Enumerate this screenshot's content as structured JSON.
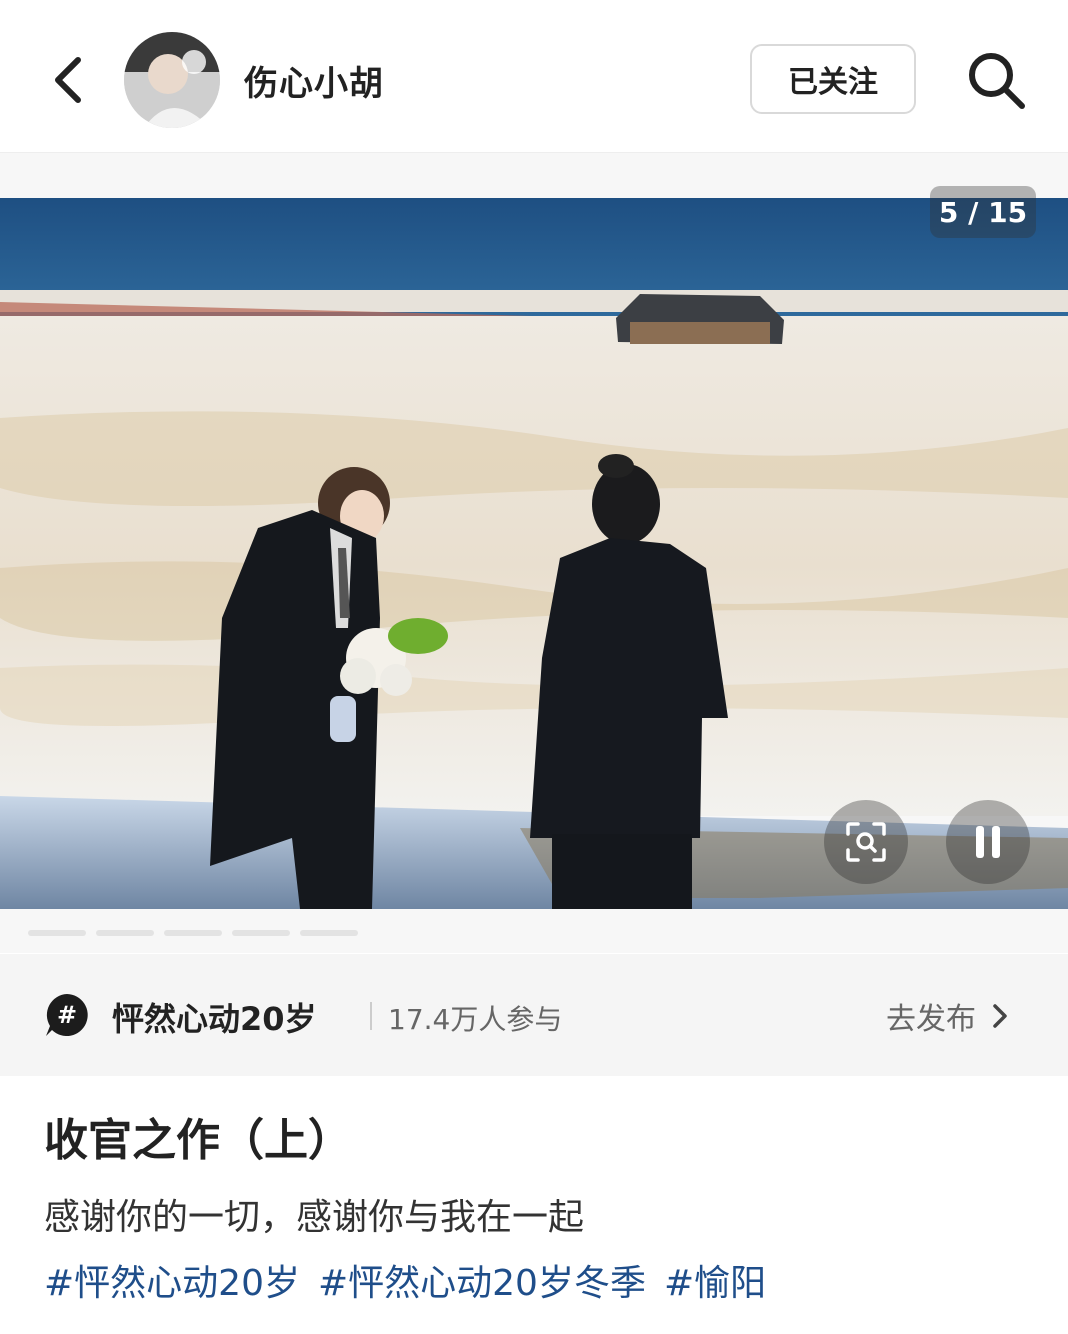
{
  "header": {
    "username": "伤心小胡",
    "follow_label": "已关注",
    "back_icon": "chevron-left-icon",
    "search_icon": "search-icon"
  },
  "media": {
    "counter": "5 / 15",
    "scan_icon": "scan-icon",
    "pause_icon": "pause-icon",
    "carousel_dots": 5
  },
  "topic": {
    "icon": "hashtag-bubble-icon",
    "name": "怦然心动20岁",
    "participants": "17.4万人参与",
    "action_label": "去发布"
  },
  "post": {
    "title": "收官之作（上）",
    "body": "感谢你的一切，感谢你与我在一起",
    "tags": [
      "#怦然心动20岁",
      "#怦然心动20岁冬季",
      "#愉阳"
    ]
  },
  "colors": {
    "tag_blue": "#1f4e8a",
    "topic_bg": "#f5f5f5"
  }
}
